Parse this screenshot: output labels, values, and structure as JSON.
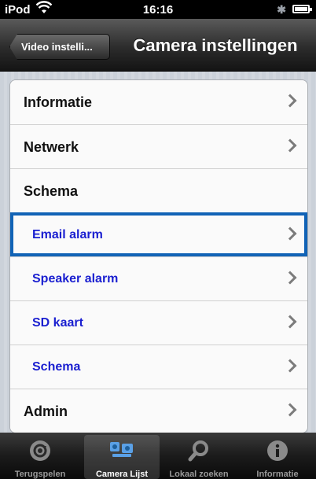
{
  "status_bar": {
    "carrier": "iPod",
    "time": "16:16",
    "bluetooth": "✱"
  },
  "nav": {
    "back_label": "Video instelli...",
    "title": "Camera instellingen"
  },
  "settings": {
    "items": [
      {
        "label": "Informatie",
        "chevron": true,
        "sub": false,
        "selected": false
      },
      {
        "label": "Netwerk",
        "chevron": true,
        "sub": false,
        "selected": false
      },
      {
        "label": "Schema",
        "chevron": false,
        "sub": false,
        "selected": false
      },
      {
        "label": "Email alarm",
        "chevron": true,
        "sub": true,
        "selected": true
      },
      {
        "label": "Speaker alarm",
        "chevron": true,
        "sub": true,
        "selected": false
      },
      {
        "label": "SD kaart",
        "chevron": true,
        "sub": true,
        "selected": false
      },
      {
        "label": "Schema",
        "chevron": true,
        "sub": true,
        "selected": false
      },
      {
        "label": "Admin",
        "chevron": true,
        "sub": false,
        "selected": false
      }
    ]
  },
  "tabs": [
    {
      "label": "Terugspelen",
      "icon": "replay-icon",
      "active": false
    },
    {
      "label": "Camera Lijst",
      "icon": "camera-list-icon",
      "active": true
    },
    {
      "label": "Lokaal zoeken",
      "icon": "search-icon",
      "active": false
    },
    {
      "label": "Informatie",
      "icon": "info-icon",
      "active": false
    }
  ],
  "colors": {
    "selection": "#1163b6",
    "sub_item_text": "#1a1fd0"
  }
}
